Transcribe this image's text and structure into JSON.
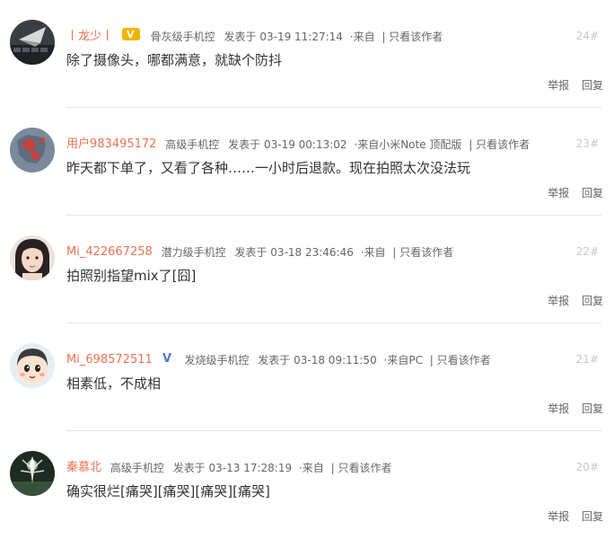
{
  "posts": [
    {
      "user": "丨龙少丨",
      "badge": "V",
      "level": "骨灰级手机控",
      "posted_label": "发表于",
      "time": "03-19 11:27:14",
      "source": "·来自",
      "only_author": "| 只看该作者",
      "floor": "24#",
      "content": "除了摄像头，哪都满意，就缺个防抖",
      "report": "举报",
      "reply": "回复"
    },
    {
      "user": "用户983495172",
      "badge": "",
      "level": "高级手机控",
      "posted_label": "发表于",
      "time": "03-19 00:13:02",
      "source": "·来自小米Note 顶配版",
      "only_author": "| 只看该作者",
      "floor": "23#",
      "content": "昨天都下单了，又看了各种……一小时后退款。现在拍照太次没法玩",
      "report": "举报",
      "reply": "回复"
    },
    {
      "user": "Mi_422667258",
      "badge": "",
      "level": "潜力级手机控",
      "posted_label": "发表于",
      "time": "03-18 23:46:46",
      "source": "·来自",
      "only_author": "| 只看该作者",
      "floor": "22#",
      "content": "拍照别指望mix了[囧]",
      "report": "举报",
      "reply": "回复"
    },
    {
      "user": "Mi_698572511",
      "badge": "V",
      "level": "发烧级手机控",
      "posted_label": "发表于",
      "time": "03-18 09:11:50",
      "source": "·来自PC",
      "only_author": "| 只看该作者",
      "floor": "21#",
      "content": "相素低，不成相",
      "report": "举报",
      "reply": "回复"
    },
    {
      "user": "秦慕北",
      "badge": "",
      "level": "高级手机控",
      "posted_label": "发表于",
      "time": "03-13 17:28:19",
      "source": "·来自",
      "only_author": "| 只看该作者",
      "floor": "20#",
      "content": "确实很烂[痛哭][痛哭][痛哭][痛哭]",
      "report": "举报",
      "reply": "回复"
    }
  ],
  "colors": {
    "username": "#eb7350",
    "meta": "#666666",
    "floor": "#c8c8c8",
    "content": "#333333",
    "badge_gold": "#f0b400",
    "badge_blue": "#4a7fd0"
  }
}
